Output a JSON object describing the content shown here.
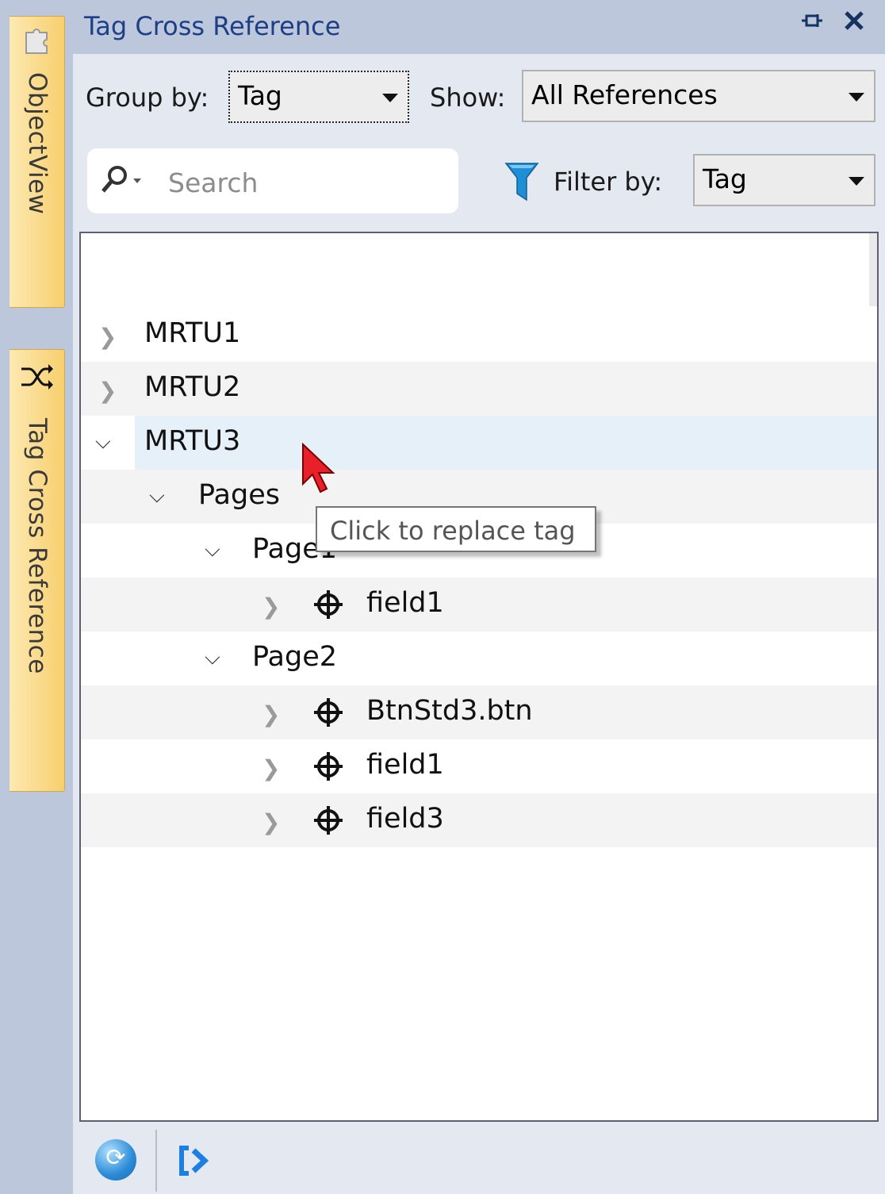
{
  "dock": {
    "tabs": [
      {
        "label": "ObjectView"
      },
      {
        "label": "Tag Cross Reference"
      }
    ]
  },
  "panel": {
    "title": "Tag Cross Reference"
  },
  "toolbar": {
    "group_by_label": "Group by:",
    "group_by_value": "Tag",
    "show_label": "Show:",
    "show_value": "All References",
    "search_placeholder": "Search",
    "filter_by_label": "Filter by:",
    "filter_by_value": "Tag"
  },
  "tree": {
    "rows": [
      {
        "label": "MRTU1",
        "expanded": false
      },
      {
        "label": "MRTU2",
        "expanded": false
      },
      {
        "label": "MRTU3",
        "expanded": true
      },
      {
        "label": "Pages",
        "expanded": true
      },
      {
        "label": "Page1",
        "expanded": true
      },
      {
        "label": "field1",
        "expanded": false
      },
      {
        "label": "Page2",
        "expanded": true
      },
      {
        "label": "BtnStd3.btn",
        "expanded": false
      },
      {
        "label": "field1",
        "expanded": false
      },
      {
        "label": "field3",
        "expanded": false
      }
    ]
  },
  "tooltip": {
    "text": "Click to replace tag"
  },
  "icons": {
    "objectview_tab": "puzzle-icon",
    "tagxref_tab": "shuffle-icon",
    "pin": "pin-icon",
    "close": "close-icon",
    "search": "magnifier-dropdown-icon",
    "filter": "funnel-icon",
    "tree_item": "crosshair-target-icon",
    "refresh": "refresh-icon",
    "go_to_reference": "go-to-reference-icon"
  },
  "colors": {
    "title_text": "#1d3f85",
    "vertical_tab": "#f7cf6d",
    "selection": "#e6f0f9",
    "filter_icon": "#1e8fd6"
  }
}
